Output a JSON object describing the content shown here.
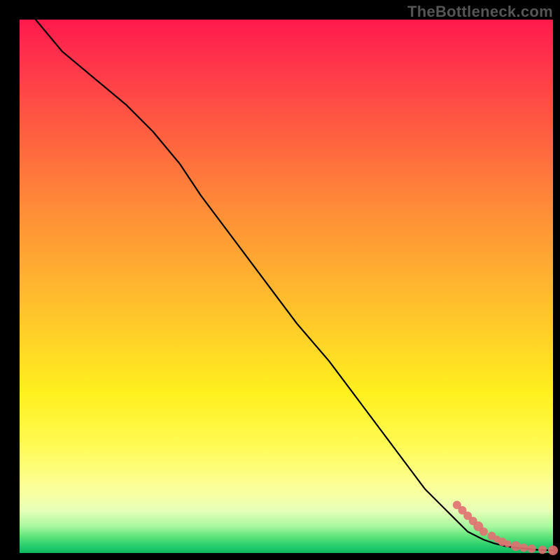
{
  "watermark": "TheBottleneck.com",
  "chart_data": {
    "type": "line",
    "title": "",
    "xlabel": "",
    "ylabel": "",
    "xlim": [
      0,
      100
    ],
    "ylim": [
      0,
      100
    ],
    "series": [
      {
        "name": "curve",
        "x": [
          3,
          8,
          14,
          20,
          25,
          30,
          34,
          40,
          46,
          52,
          58,
          64,
          70,
          76,
          81,
          84,
          87,
          89,
          91,
          93,
          95,
          97,
          100
        ],
        "y": [
          100,
          94,
          89,
          84,
          79,
          73,
          67,
          59,
          51,
          43,
          36,
          28,
          20,
          12,
          7,
          4,
          2.5,
          1.8,
          1.3,
          1.0,
          0.8,
          0.6,
          0.5
        ]
      },
      {
        "name": "points",
        "x": [
          82,
          83,
          84,
          85,
          86,
          87,
          88.5,
          89.5,
          90.5,
          91.5,
          93,
          94.5,
          96,
          98,
          100
        ],
        "y": [
          9,
          8,
          7,
          6,
          5,
          4,
          3.2,
          2.6,
          2.1,
          1.7,
          1.3,
          1.0,
          0.8,
          0.6,
          0.5
        ],
        "sizes": [
          6,
          6,
          6,
          6,
          7,
          6,
          6,
          5,
          6,
          5,
          7,
          6,
          6,
          6,
          7
        ]
      }
    ],
    "background_gradient": {
      "top": "#ff1a4d",
      "mid": "#ffe02a",
      "bottom": "#11b85f"
    }
  }
}
